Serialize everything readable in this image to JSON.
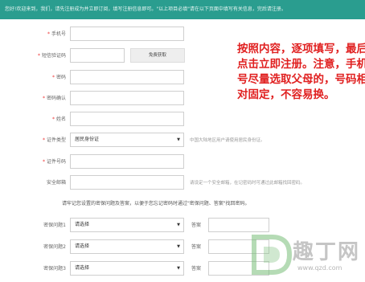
{
  "topbar": {
    "notice": "您好!欢迎来到，我们，请先注册成为并立即订阅，填写注册信息即可。\"以上项目必填\"请在以下页面中填写有关信息，完后请注册。"
  },
  "form": {
    "phone_label": "手机号",
    "sms_code_label": "短信验证码",
    "get_code_button": "免费获取",
    "password_label": "密码",
    "confirm_password_label": "密码确认",
    "name_label": "姓名",
    "id_type_label": "证件类型",
    "id_type_value": "居民身份证",
    "id_type_hint": "中国大陆地区用户请使用居民身份证。",
    "id_number_label": "证件号码",
    "email_label": "安全邮箱",
    "email_hint": "请设定一个安全邮箱，在记密码时可通过此邮箱找回密码。",
    "security_note": "请牢记您设置的密保问题及答案，以便于您忘记密码时通过\"密保问题、答案\"找回密码。",
    "questions": [
      {
        "label": "密保问题1",
        "select": "请选择",
        "answer_label": "答案"
      },
      {
        "label": "密保问题2",
        "select": "请选择",
        "answer_label": "答案"
      },
      {
        "label": "密保问题3",
        "select": "请选择",
        "answer_label": "答案"
      }
    ],
    "required_mark": "*"
  },
  "overlay_note": "按照内容，逐项填写，最后点击立即注册。注意，手机号尽量选取父母的，号码相对固定，不容易换。",
  "watermark": {
    "text": "趣丁网",
    "url": "www.qzd.com"
  },
  "colors": {
    "topbar": "#2a9d8f",
    "required": "#e33333",
    "overlay_text": "#e02020"
  }
}
